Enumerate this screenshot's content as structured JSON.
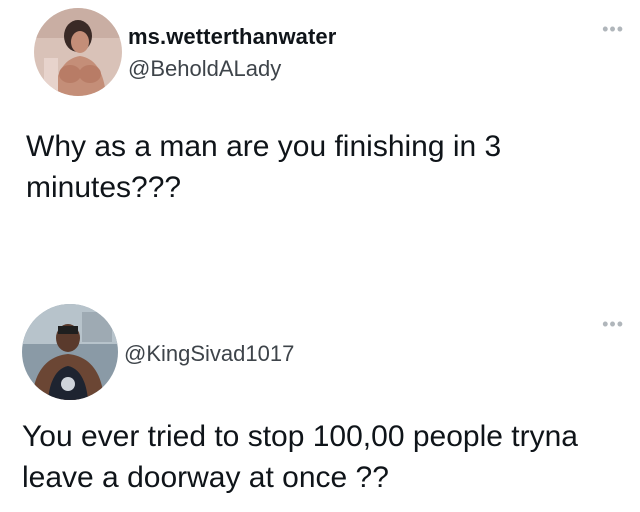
{
  "tweets": [
    {
      "display_name": "ms.wetterthanwater",
      "handle": "@BeholdALady",
      "text": "Why as a man are you finishing in 3 minutes???",
      "more_glyph": "•••",
      "avatar_icon": "profile-photo"
    },
    {
      "display_name": "",
      "handle": "@KingSivad1017",
      "text": "You ever tried to stop 100,00 people tryna leave a doorway at once ??",
      "more_glyph": "•••",
      "avatar_icon": "profile-photo"
    }
  ],
  "colors": {
    "text": "#0f1419",
    "handle": "#3e444a",
    "more_icon": "#b0b6bb",
    "background": "#ffffff"
  }
}
